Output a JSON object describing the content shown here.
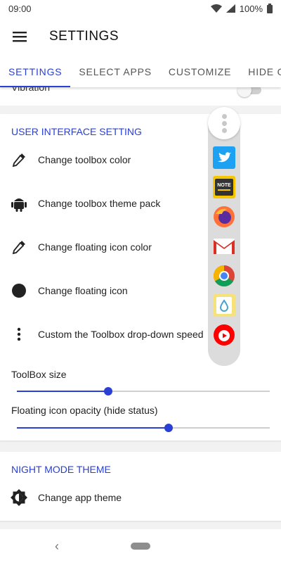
{
  "status": {
    "time": "09:00",
    "battery": "100%"
  },
  "appbar": {
    "title": "SETTINGS"
  },
  "tabs": [
    {
      "label": "SETTINGS",
      "active": true
    },
    {
      "label": "SELECT APPS",
      "active": false
    },
    {
      "label": "CUSTOMIZE",
      "active": false
    },
    {
      "label": "HIDE ON",
      "active": false
    }
  ],
  "peek": {
    "label": "Vibration",
    "toggle_on": false
  },
  "ui_section": {
    "title": "USER INTERFACE SETTING",
    "items": [
      {
        "icon": "eyedropper-icon",
        "label": "Change toolbox color"
      },
      {
        "icon": "android-icon",
        "label": "Change toolbox theme pack"
      },
      {
        "icon": "eyedropper-icon",
        "label": "Change floating icon color"
      },
      {
        "icon": "filled-circle-icon",
        "label": "Change floating icon"
      },
      {
        "icon": "more-vert-icon",
        "label": "Custom the Toolbox drop-down speed"
      }
    ],
    "sliders": [
      {
        "label": "ToolBox size",
        "value": 0.36
      },
      {
        "label": "Floating icon opacity (hide status)",
        "value": 0.6
      }
    ]
  },
  "night_section": {
    "title": "NIGHT MODE THEME",
    "items": [
      {
        "icon": "brightness-icon",
        "label": "Change app theme"
      }
    ]
  },
  "toolbox_apps": [
    {
      "name": "twitter-icon",
      "color": "#1da1f2"
    },
    {
      "name": "note-icon",
      "color": "#f7c600"
    },
    {
      "name": "firefox-icon",
      "color": "#ff7139"
    },
    {
      "name": "gmail-icon",
      "color": "#d93025"
    },
    {
      "name": "chrome-icon",
      "color": "#4285f4"
    },
    {
      "name": "drop-app-icon",
      "color": "#f5e27a"
    },
    {
      "name": "youtube-icon",
      "color": "#ff0000"
    }
  ],
  "colors": {
    "accent": "#2a3fd4",
    "background": "#f2f2f2"
  }
}
